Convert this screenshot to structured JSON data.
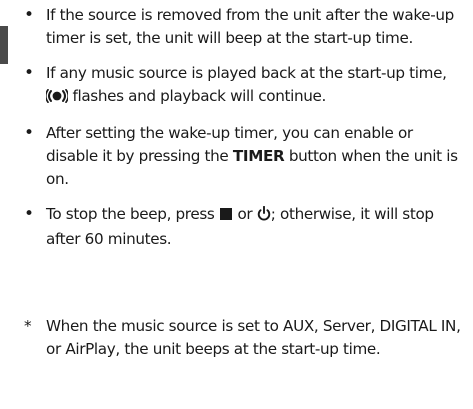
{
  "notes": [
    {
      "text": "If the source is removed from the unit after the wake-up timer is set, the unit will beep at the start-up time."
    },
    {
      "before": "If any music source is played back at the start-up time, ",
      "icon": "radio-waves-icon",
      "after": " flashes and playback will continue."
    },
    {
      "before": "After setting the wake-up timer, you can enable or disable it by pressing the ",
      "bold": "TIMER",
      "after": " button when the unit is on."
    },
    {
      "before": "To stop the beep, press ",
      "icon1": "stop-square-icon",
      "middle": " or ",
      "icon2": "power-icon",
      "after": "; otherwise, it will stop after 60 minutes."
    }
  ],
  "footnote": {
    "marker": "*",
    "text": "When the music source is set to AUX, Server, DIGITAL IN, or AirPlay, the unit beeps at the start-up time."
  }
}
